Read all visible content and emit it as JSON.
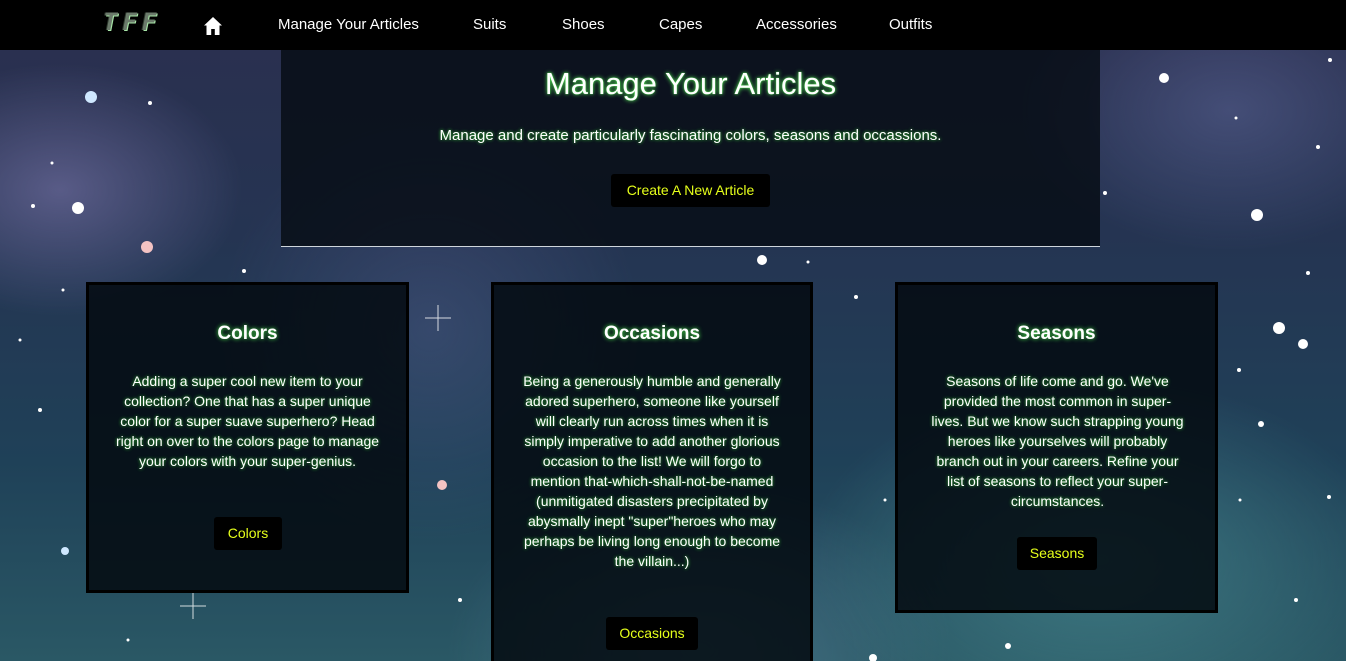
{
  "navbar": {
    "logo": "TFF",
    "home_icon": "home-icon",
    "links": [
      "Manage Your Articles",
      "Suits",
      "Shoes",
      "Capes",
      "Accessories",
      "Outfits"
    ]
  },
  "header": {
    "title": "Manage Your Articles",
    "subtitle": "Manage and create particularly fascinating colors, seasons and occassions.",
    "button_label": "Create A New Article"
  },
  "cards": [
    {
      "title": "Colors",
      "text": "Adding a super cool new item to your collection? One that has a super unique color for a super suave superhero? Head right on over to the colors page to manage your colors with your super-genius.",
      "button_label": "Colors"
    },
    {
      "title": "Occasions",
      "text": "Being a generously humble and generally adored superhero, someone like yourself will clearly run across times when it is simply imperative to add another glorious occasion to the list! We will forgo to mention that-which-shall-not-be-named (unmitigated disasters precipitated by abysmally inept \"super\"heroes who may perhaps be living long enough to become the villain...)",
      "button_label": "Occasions"
    },
    {
      "title": "Seasons",
      "text": "Seasons of life come and go. We've provided the most common in super-lives. But we know such strapping young heroes like yourselves will probably branch out in your careers. Refine your list of seasons to reflect your super-circumstances.",
      "button_label": "Seasons"
    }
  ],
  "colors": {
    "navbar_bg": "#000000",
    "button_text": "#e6ff1a",
    "glow": "#4cf04c"
  }
}
